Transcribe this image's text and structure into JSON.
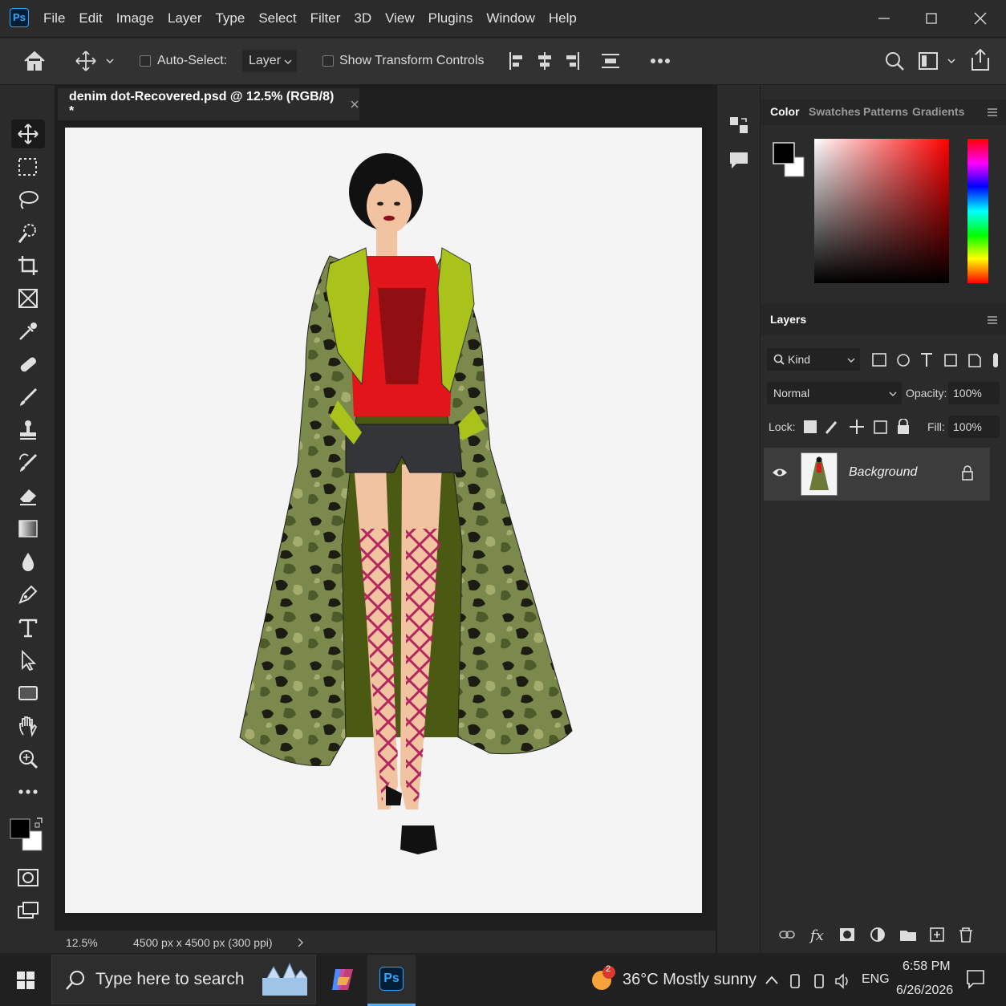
{
  "app": {
    "logo": "Ps",
    "name": "Photoshop"
  },
  "menu": [
    "File",
    "Edit",
    "Image",
    "Layer",
    "Type",
    "Select",
    "Filter",
    "3D",
    "View",
    "Plugins",
    "Window",
    "Help"
  ],
  "options": {
    "auto_select_label": "Auto-Select:",
    "layer_select_value": "Layer",
    "show_transform_label": "Show Transform Controls",
    "auto_select_checked": false,
    "show_transform_checked": false
  },
  "document": {
    "tab_title": "denim dot-Recovered.psd @ 12.5% (RGB/8) *",
    "zoom": "12.5%",
    "info": "4500 px x 4500 px (300 ppi)"
  },
  "color_panel": {
    "tabs": [
      "Color",
      "Swatches",
      "Patterns",
      "Gradients"
    ],
    "active_tab": "Color",
    "foreground": "#000000",
    "background": "#ffffff",
    "hue": "#ff0000"
  },
  "layers_panel": {
    "title": "Layers",
    "filter_label": "Kind",
    "blend_mode": "Normal",
    "opacity_label": "Opacity:",
    "opacity_value": "100%",
    "lock_label": "Lock:",
    "fill_label": "Fill:",
    "fill_value": "100%",
    "layers": [
      {
        "name": "Background",
        "visible": true,
        "locked": true
      }
    ]
  },
  "taskbar": {
    "search_placeholder": "Type here to search",
    "weather_badge": "2",
    "weather": "36°C  Mostly sunny",
    "language": "ENG",
    "time": "6:58 PM",
    "date": "6/26/2026"
  },
  "icons": [
    "home-icon",
    "move-icon",
    "marquee-icon",
    "lasso-icon",
    "quick-select-icon",
    "crop-icon",
    "frame-icon",
    "eyedropper-icon",
    "healing-icon",
    "brush-icon",
    "stamp-icon",
    "history-brush-icon",
    "eraser-icon",
    "gradient-icon",
    "blur-icon",
    "pen-icon",
    "type-icon",
    "path-select-icon",
    "rectangle-icon",
    "hand-icon",
    "zoom-icon",
    "more-icon",
    "eye-icon",
    "lock-icon",
    "windows-icon",
    "search-icon"
  ]
}
